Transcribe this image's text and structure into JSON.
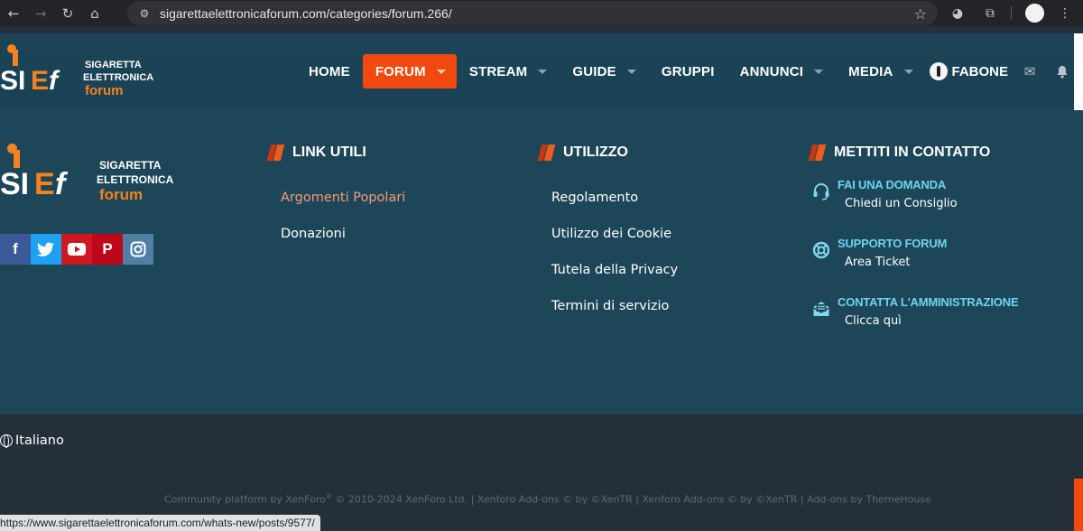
{
  "browser": {
    "url": "sigarettaelettronicaforum.com/categories/forum.266/",
    "status_url": "https://www.sigarettaelettronicaforum.com/whats-new/posts/9577/"
  },
  "header": {
    "logo_alt": "SIGARETTA ELETTRONICA forum",
    "nav": [
      {
        "label": "HOME",
        "dropdown": false,
        "active": false
      },
      {
        "label": "FORUM",
        "dropdown": true,
        "active": true
      },
      {
        "label": "STREAM",
        "dropdown": true,
        "active": false
      },
      {
        "label": "GUIDE",
        "dropdown": true,
        "active": false
      },
      {
        "label": "GRUPPI",
        "dropdown": false,
        "active": false
      },
      {
        "label": "ANNUNCI",
        "dropdown": true,
        "active": false
      },
      {
        "label": "MEDIA",
        "dropdown": true,
        "active": false
      }
    ],
    "username": "FABONE",
    "accent_color": "#f04a10"
  },
  "footer": {
    "logo_text": {
      "line1": "SIGARETTA",
      "line2": "ELETTRONICA",
      "line3": "forum"
    },
    "socials": [
      {
        "icon": "facebook-icon",
        "glyph": "f",
        "color": "#3b5998"
      },
      {
        "icon": "twitter-icon",
        "glyph": "🐦",
        "color": "#1da1f2"
      },
      {
        "icon": "youtube-icon",
        "glyph": "▶",
        "color": "#cc181e"
      },
      {
        "icon": "pinterest-icon",
        "glyph": "P",
        "color": "#bd081c"
      },
      {
        "icon": "instagram-icon",
        "glyph": "◎",
        "color": "#517fa4"
      }
    ],
    "link_utili": {
      "title": "LINK UTILI",
      "links": [
        "Argomenti Popolari",
        "Donazioni"
      ]
    },
    "utilizzo": {
      "title": "UTILIZZO",
      "links": [
        "Regolamento",
        "Utilizzo dei Cookie",
        "Tutela della Privacy",
        "Termini di servizio"
      ]
    },
    "contatto": {
      "title": "METTITI IN CONTATTO",
      "items": [
        {
          "title": "FAI UNA DOMANDA",
          "sub": "Chiedi un Consiglio",
          "icon": "headset-icon"
        },
        {
          "title": "SUPPORTO FORUM",
          "sub": "Area Ticket",
          "icon": "lifebuoy-icon"
        },
        {
          "title": "CONTATTA L'AMMINISTRAZIONE",
          "sub": "Clicca quì",
          "icon": "envelope-open-icon"
        }
      ]
    },
    "language": "Italiano",
    "credits": {
      "a": "Community platform by XenForo",
      "b": " © 2010-2024 XenForo Ltd.  |  Xenforo Add-ons © by ©XenTR  |  Xenforo Add-ons © by ©XenTR  | Add-ons by ThemeHouse"
    }
  }
}
